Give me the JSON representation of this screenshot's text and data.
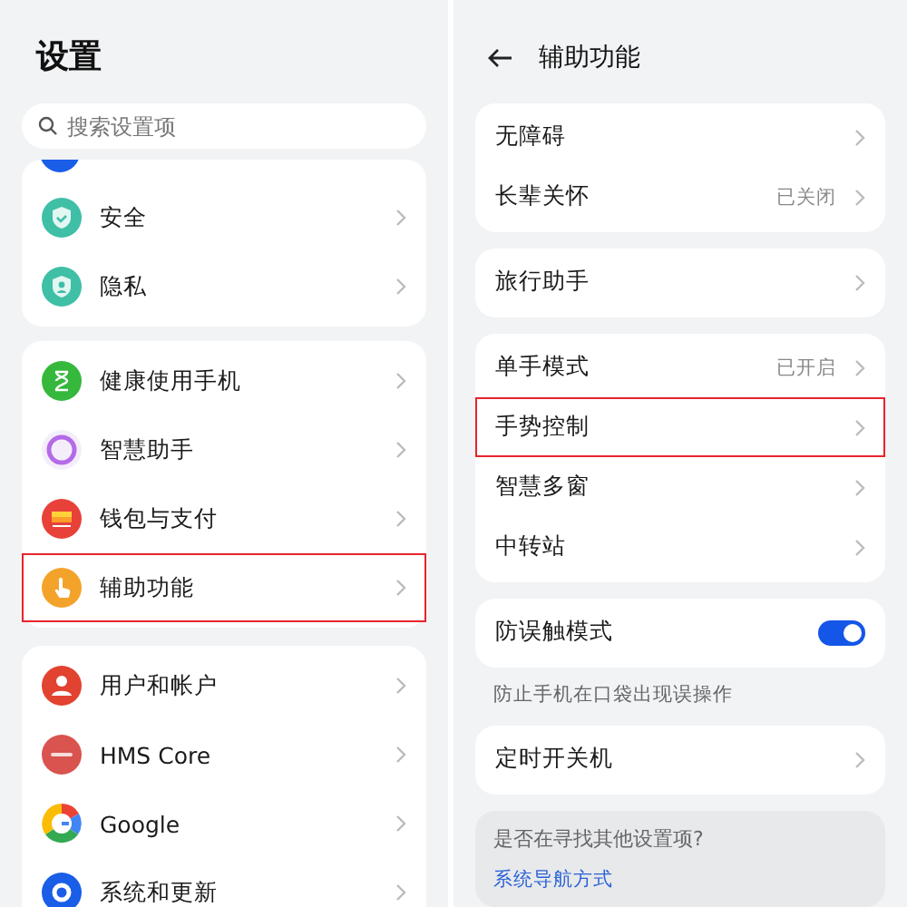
{
  "settings": {
    "title": "设置",
    "search": {
      "placeholder": "搜索设置项"
    },
    "groups": [
      {
        "items": [
          {
            "label": "安全",
            "highlighted": false
          },
          {
            "label": "隐私",
            "highlighted": false
          }
        ]
      },
      {
        "items": [
          {
            "label": "健康使用手机",
            "highlighted": false
          },
          {
            "label": "智慧助手",
            "highlighted": false
          },
          {
            "label": "钱包与支付",
            "highlighted": false
          },
          {
            "label": "辅助功能",
            "highlighted": true
          }
        ]
      },
      {
        "items": [
          {
            "label": "用户和帐户",
            "highlighted": false
          },
          {
            "label": "HMS Core",
            "highlighted": false
          },
          {
            "label": "Google",
            "highlighted": false
          },
          {
            "label": "系统和更新",
            "highlighted": false
          }
        ]
      }
    ]
  },
  "accessibility": {
    "title": "辅助功能",
    "groups": [
      {
        "items": [
          {
            "kind": "link",
            "label": "无障碍",
            "highlighted": false
          },
          {
            "kind": "link",
            "label": "长辈关怀",
            "value": "已关闭",
            "highlighted": false
          }
        ]
      },
      {
        "items": [
          {
            "kind": "link",
            "label": "旅行助手",
            "highlighted": false
          }
        ]
      },
      {
        "items": [
          {
            "kind": "link",
            "label": "单手模式",
            "value": "已开启",
            "highlighted": false
          },
          {
            "kind": "link",
            "label": "手势控制",
            "highlighted": true
          },
          {
            "kind": "link",
            "label": "智慧多窗",
            "highlighted": false
          },
          {
            "kind": "link",
            "label": "中转站",
            "highlighted": false
          }
        ]
      },
      {
        "items": [
          {
            "kind": "toggle",
            "label": "防误触模式",
            "on": true,
            "highlighted": false
          }
        ],
        "caption": "防止手机在口袋出现误操作"
      },
      {
        "items": [
          {
            "kind": "link",
            "label": "定时开关机",
            "highlighted": false
          }
        ]
      }
    ],
    "suggestion": {
      "question": "是否在寻找其他设置项?",
      "link": "系统导航方式"
    }
  }
}
